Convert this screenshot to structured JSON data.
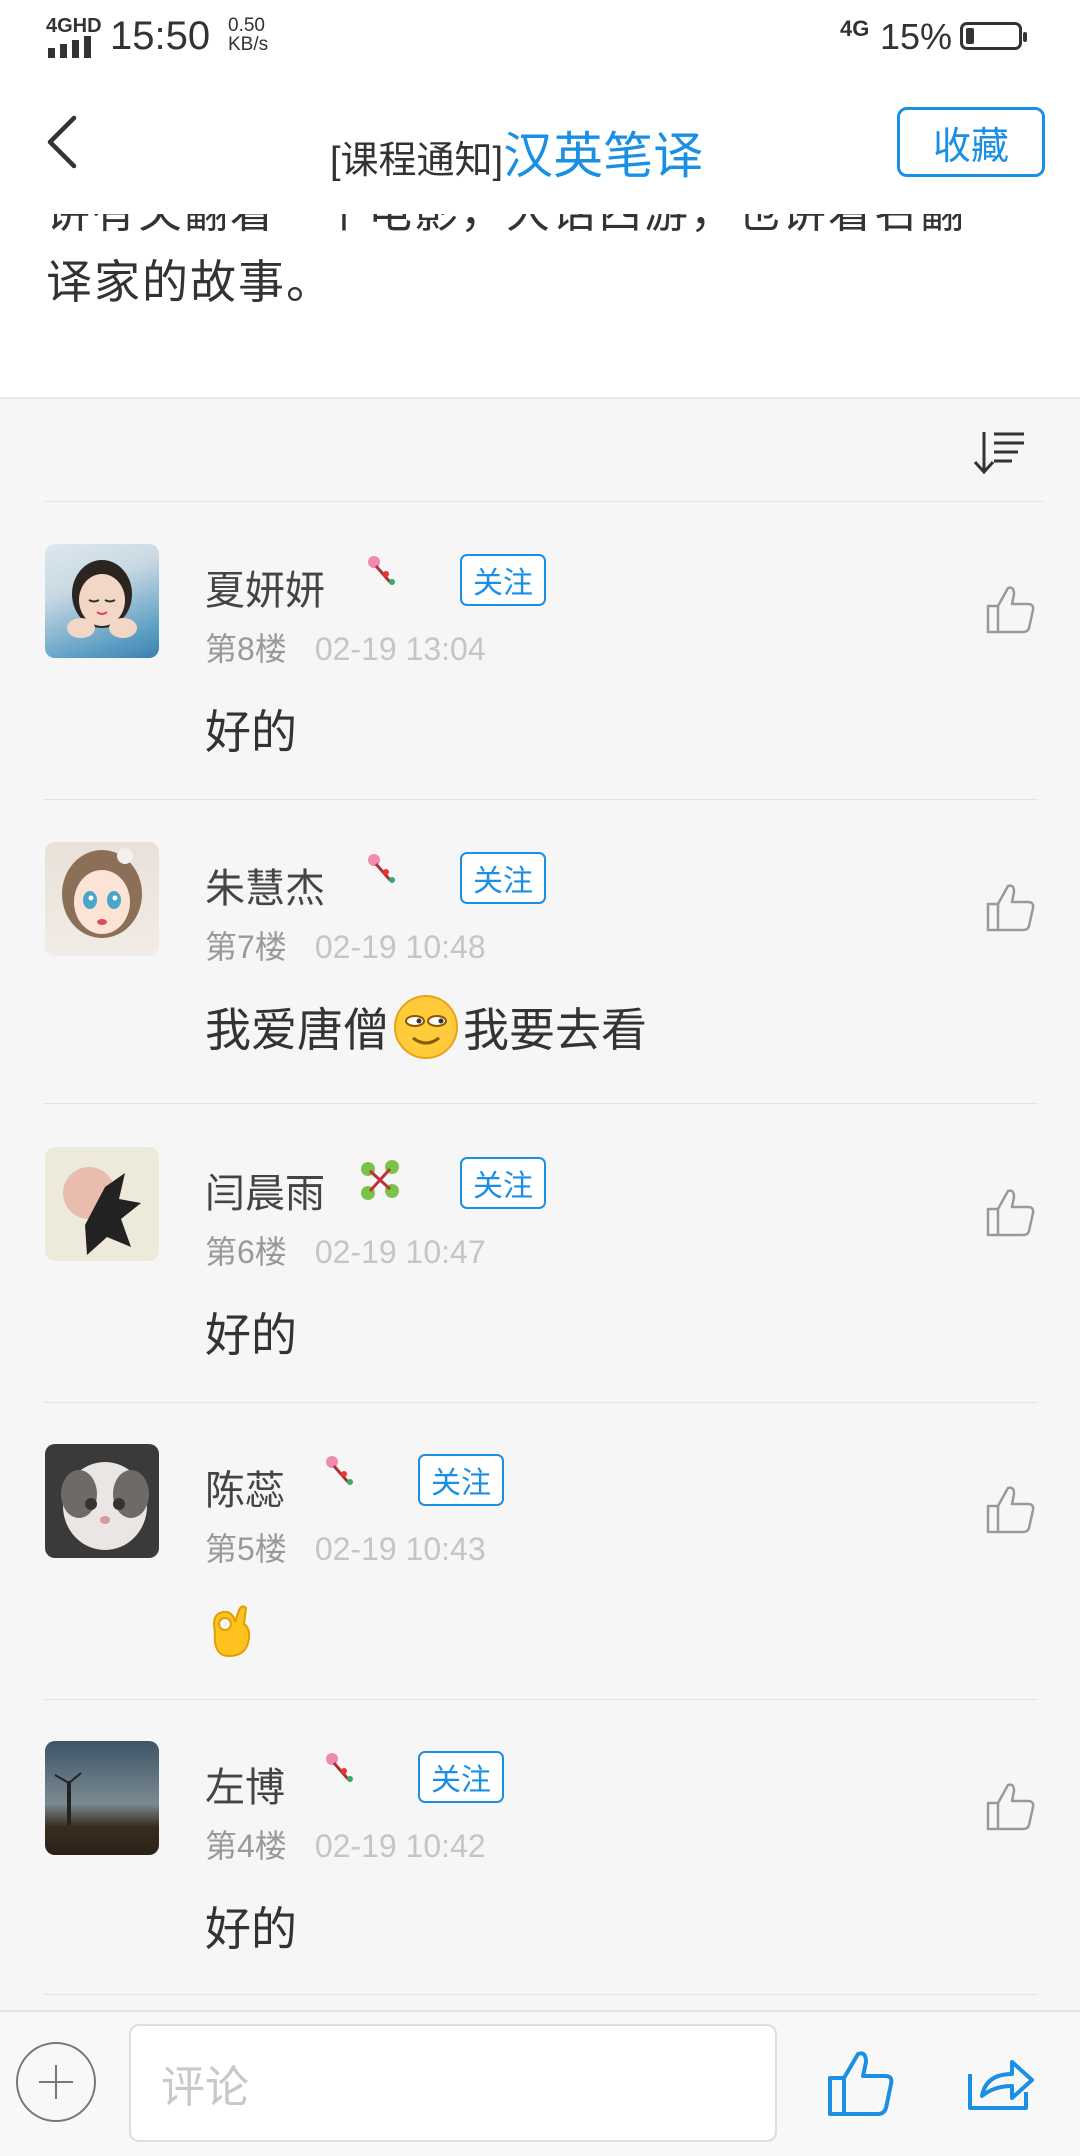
{
  "status_bar": {
    "network": "4GHD",
    "time": "15:50",
    "speed_value": "0.50",
    "speed_unit": "KB/s",
    "network_right": "4G",
    "battery": "15%"
  },
  "header": {
    "tag": "[课程通知]",
    "course": "汉英笔译",
    "favorite_label": "收藏"
  },
  "article": {
    "clipped_line": "讲有关翻着一个电影，大话西游，也讲着名翻",
    "text": "译家的故事。"
  },
  "comments": [
    {
      "name": "夏妍妍",
      "floor": "第8楼",
      "time": "02-19 13:04",
      "content": "好的",
      "follow_label": "关注",
      "badge": "pink-flower-icon"
    },
    {
      "name": "朱慧杰",
      "floor": "第7楼",
      "time": "02-19 10:48",
      "content_before": "我爱唐僧",
      "content_after": "我要去看",
      "emoji": "squinting-smiley-icon",
      "follow_label": "关注",
      "badge": "pink-flower-icon"
    },
    {
      "name": "闫晨雨",
      "floor": "第6楼",
      "time": "02-19 10:47",
      "content": "好的",
      "follow_label": "关注",
      "badge": "green-clover-icon"
    },
    {
      "name": "陈蕊",
      "floor": "第5楼",
      "time": "02-19 10:43",
      "content_emoji": "ok-hand-icon",
      "follow_label": "关注",
      "badge": "pink-flower-icon"
    },
    {
      "name": "左博",
      "floor": "第4楼",
      "time": "02-19 10:42",
      "content": "好的",
      "follow_label": "关注",
      "badge": "pink-flower-icon"
    }
  ],
  "bottom_bar": {
    "comment_placeholder": "评论"
  },
  "colors": {
    "accent": "#1a8fe3",
    "background": "#f6f6f6"
  }
}
